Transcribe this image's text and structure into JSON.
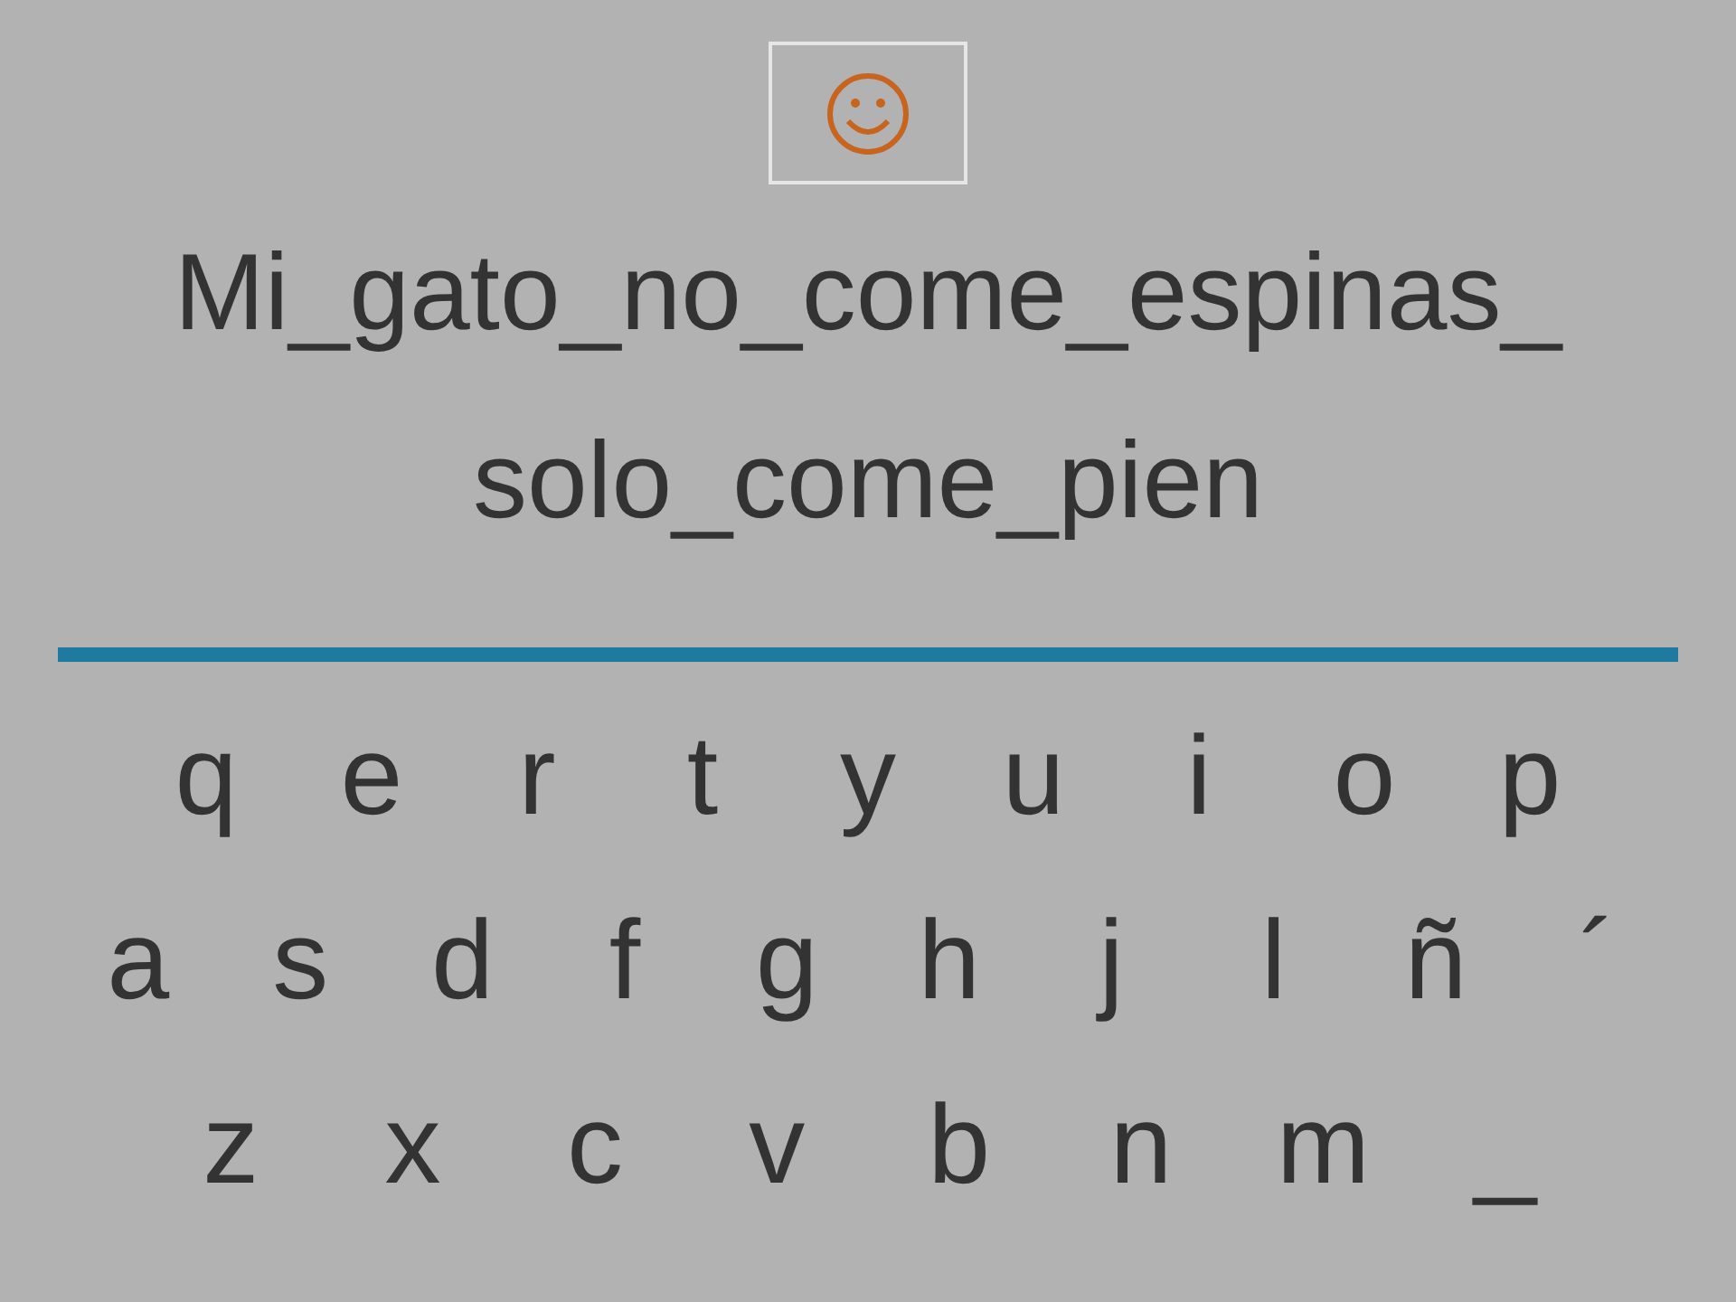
{
  "sentence_lines": [
    "Mi_gato_no_come_espinas_",
    "solo_come_pien"
  ],
  "keyboard_rows": [
    [
      "q",
      "e",
      "r",
      "t",
      "y",
      "u",
      "i",
      "o",
      "p"
    ],
    [
      "a",
      "s",
      "d",
      "f",
      "g",
      "h",
      "j",
      "l",
      "ñ",
      "´"
    ],
    [
      "z",
      "x",
      "c",
      "v",
      "b",
      "n",
      "m",
      "_"
    ]
  ]
}
